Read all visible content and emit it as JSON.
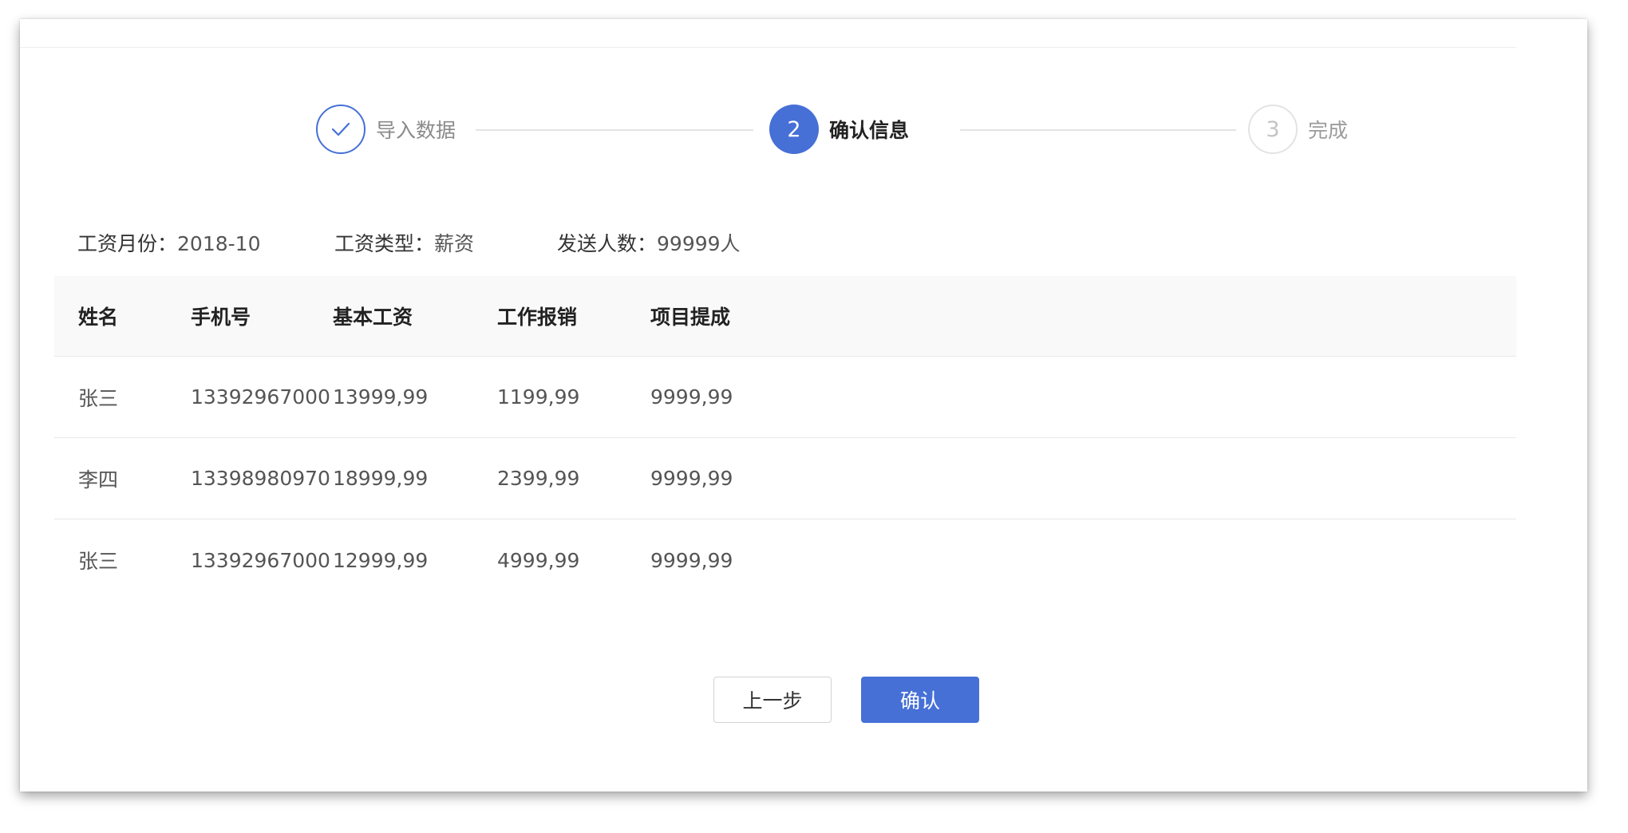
{
  "steps": [
    {
      "number": "1",
      "label": "导入数据",
      "state": "done"
    },
    {
      "number": "2",
      "label": "确认信息",
      "state": "active"
    },
    {
      "number": "3",
      "label": "完成",
      "state": "pending"
    }
  ],
  "summary": {
    "month_label": "工资月份：",
    "month_value": "2018-10",
    "type_label": "工资类型：",
    "type_value": "薪资",
    "count_label": "发送人数：",
    "count_value": "99999人"
  },
  "table": {
    "headers": [
      "姓名",
      "手机号",
      "基本工资",
      "工作报销",
      "项目提成"
    ],
    "rows": [
      [
        "张三",
        "13392967000",
        "13999,99",
        "1199,99",
        "9999,99"
      ],
      [
        "李四",
        "13398980970",
        "18999,99",
        "2399,99",
        "9999,99"
      ],
      [
        "张三",
        "13392967000",
        "12999,99",
        "4999,99",
        "9999,99"
      ]
    ]
  },
  "buttons": {
    "prev_label": "上一步",
    "confirm_label": "确认"
  },
  "colors": {
    "accent": "#4670d6",
    "pending": "#c4c4c4"
  },
  "icons": {
    "step1": "check-icon"
  }
}
